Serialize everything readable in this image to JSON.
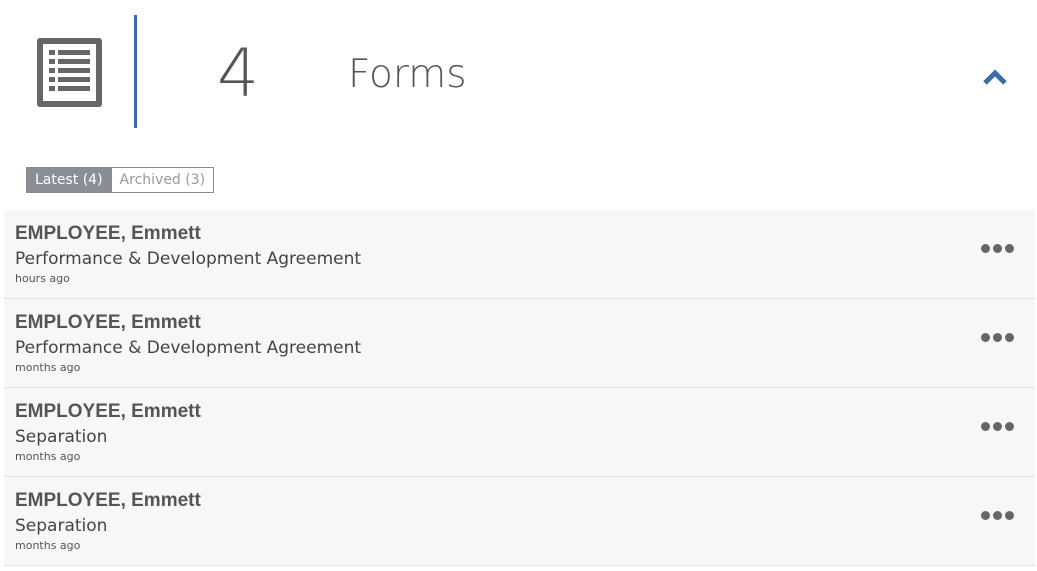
{
  "header": {
    "count": "4",
    "title": "Forms",
    "icon": "form-list-icon",
    "collapse_icon": "chevron-up-icon",
    "accent_color": "#3b6ea8"
  },
  "tabs": [
    {
      "label": "Latest (4)",
      "active": true
    },
    {
      "label": "Archived (3)",
      "active": false
    }
  ],
  "items": [
    {
      "name": "EMPLOYEE, Emmett",
      "form": "Performance & Development Agreement",
      "time": "hours ago"
    },
    {
      "name": "EMPLOYEE, Emmett",
      "form": "Performance & Development Agreement",
      "time": "months ago"
    },
    {
      "name": "EMPLOYEE, Emmett",
      "form": "Separation",
      "time": "months ago"
    },
    {
      "name": "EMPLOYEE, Emmett",
      "form": "Separation",
      "time": "months ago"
    }
  ],
  "item_menu_icon": "more-horizontal-icon"
}
